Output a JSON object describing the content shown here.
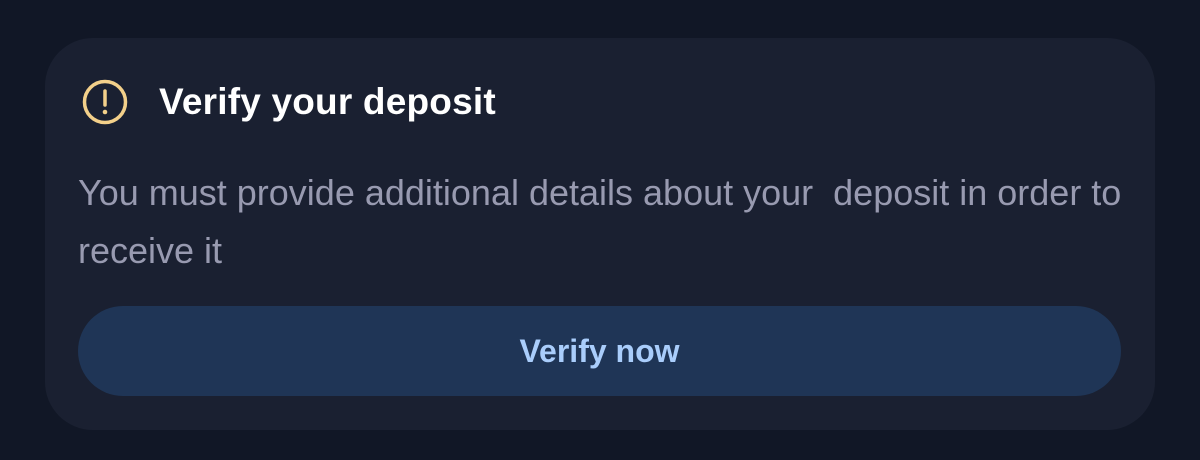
{
  "card": {
    "icon": "warning-circle-icon",
    "title": "Verify your deposit",
    "message": "You must provide additional details about your  deposit in order to receive it",
    "button_label": "Verify now"
  },
  "colors": {
    "page_background": "#111726",
    "card_background": "#1a2031",
    "title": "#ffffff",
    "message": "#989ab0",
    "icon": "#f3d08a",
    "button_background": "#1f3556",
    "button_text": "#a9cdfb"
  }
}
